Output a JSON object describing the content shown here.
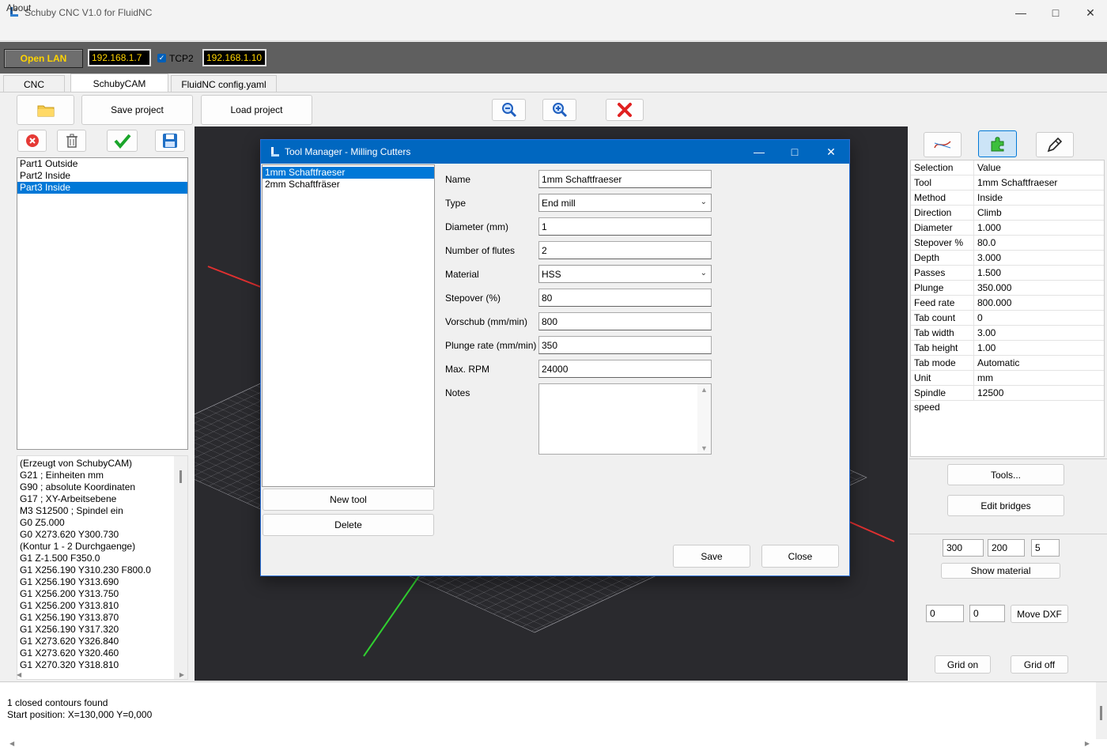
{
  "app": {
    "title": "Schuby CNC  V1.0 for FluidNC",
    "menu": [
      "About"
    ]
  },
  "connection": {
    "open_lan": "Open LAN",
    "ip1": "192.168.1.7",
    "tcp2_label": "TCP2",
    "tcp2_checked": true,
    "ip2": "192.168.1.10"
  },
  "tabs": [
    {
      "label": "CNC"
    },
    {
      "label": "SchubyCAM"
    },
    {
      "label": "FluidNC config.yaml"
    }
  ],
  "toolbar": {
    "save_project": "Save project",
    "load_project": "Load project"
  },
  "parts": [
    "Part1 Outside",
    "Part2 Inside",
    "Part3 Inside"
  ],
  "gcode": [
    "(Erzeugt von SchubyCAM)",
    "G21 ; Einheiten mm",
    "G90 ; absolute Koordinaten",
    "G17 ; XY-Arbeitsebene",
    "M3 S12500 ; Spindel ein",
    "G0 Z5.000",
    "G0 X273.620 Y300.730",
    "(Kontur 1 - 2 Durchgaenge)",
    "G1 Z-1.500 F350.0",
    "G1 X256.190 Y310.230 F800.0",
    "G1 X256.190 Y313.690",
    "G1 X256.200 Y313.750",
    "G1 X256.200 Y313.810",
    "G1 X256.190 Y313.870",
    "G1 X256.190 Y317.320",
    "G1 X273.620 Y326.840",
    "G1 X273.620 Y320.460",
    "G1 X270.320 Y318.810"
  ],
  "properties": {
    "header": [
      "Selection",
      "Value"
    ],
    "rows": [
      [
        "Tool",
        "1mm Schaftfraeser"
      ],
      [
        "Method",
        "Inside"
      ],
      [
        "Direction",
        "Climb"
      ],
      [
        "Diameter",
        "1.000"
      ],
      [
        "Stepover %",
        "80.0"
      ],
      [
        "Depth",
        "3.000"
      ],
      [
        "Passes",
        "1.500"
      ],
      [
        "Plunge",
        "350.000"
      ],
      [
        "Feed rate",
        "800.000"
      ],
      [
        "Tab count",
        "0"
      ],
      [
        "Tab width",
        "3.00"
      ],
      [
        "Tab height",
        "1.00"
      ],
      [
        "Tab mode",
        "Automatic"
      ],
      [
        "Unit",
        "mm"
      ],
      [
        "Spindle speed",
        "12500"
      ]
    ]
  },
  "right_buttons": {
    "tools": "Tools...",
    "edit_bridges": "Edit bridges",
    "show_material": "Show material",
    "move_dxf": "Move DXF",
    "grid_on": "Grid on",
    "grid_off": "Grid off"
  },
  "material": {
    "x": "300",
    "y": "200",
    "z": "5"
  },
  "dxf_offset": {
    "x": "0",
    "y": "0"
  },
  "log": [
    "1 closed contours found",
    "Start position: X=130,000 Y=0,000"
  ],
  "dialog": {
    "title": "Tool Manager - Milling Cutters",
    "tools": [
      "1mm Schaftfraeser",
      "2mm Schaftfräser"
    ],
    "new_tool": "New tool",
    "delete": "Delete",
    "save": "Save",
    "close": "Close",
    "fields": {
      "name_label": "Name",
      "name": "1mm Schaftfraeser",
      "type_label": "Type",
      "type": "End mill",
      "diameter_label": "Diameter (mm)",
      "diameter": "1",
      "flutes_label": "Number of flutes",
      "flutes": "2",
      "material_label": "Material",
      "material": "HSS",
      "stepover_label": "Stepover (%)",
      "stepover": "80",
      "feed_label": "Vorschub (mm/min)",
      "feed": "800",
      "plunge_label": "Plunge rate (mm/min)",
      "plunge": "350",
      "rpm_label": "Max. RPM",
      "rpm": "24000",
      "notes_label": "Notes",
      "notes": ""
    }
  }
}
